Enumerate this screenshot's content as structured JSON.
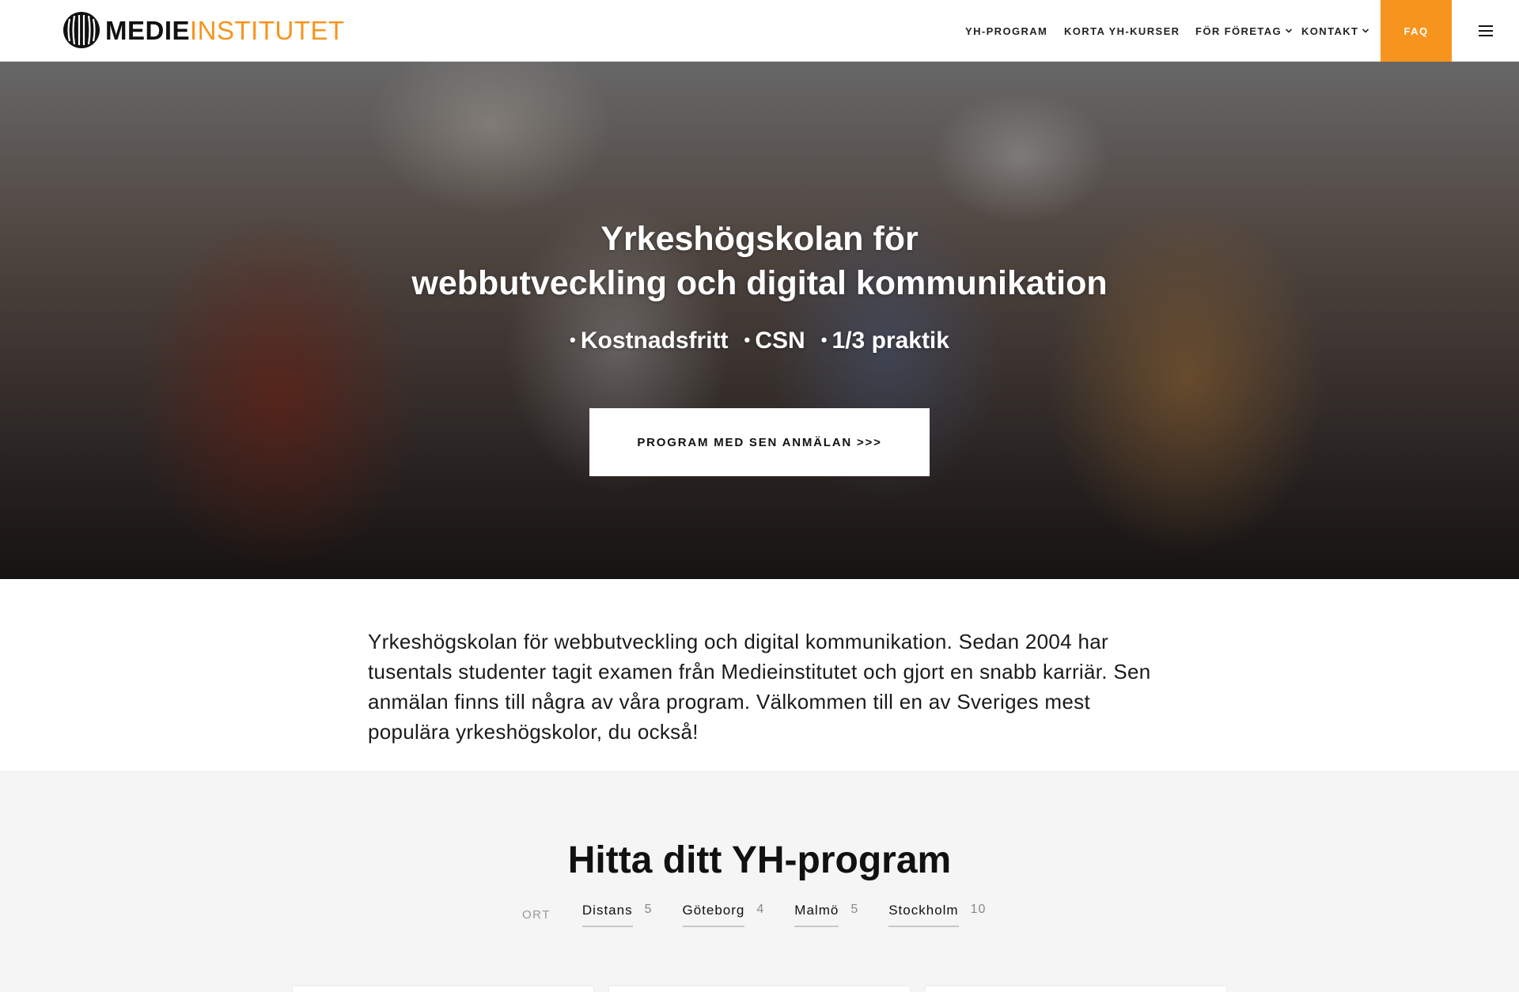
{
  "header": {
    "logo": {
      "part1": "MEDIE",
      "part2": "INSTITUTET"
    },
    "nav": [
      {
        "label": "YH-PROGRAM"
      },
      {
        "label": "KORTA YH-KURSER"
      },
      {
        "label": "FÖR FÖRETAG"
      },
      {
        "label": "KONTAKT"
      }
    ],
    "faq_label": "FAQ",
    "menu_icon": "hamburger-icon"
  },
  "hero": {
    "title_line1": "Yrkeshögskolan för",
    "title_line2": "webbutveckling och digital kommunikation",
    "bullets": [
      "Kostnadsfritt",
      "CSN",
      "1/3 praktik"
    ],
    "button_label": "PROGRAM MED SEN ANMÄLAN >>>"
  },
  "intro": {
    "text": "Yrkeshögskolan för webbutveckling och digital kommunikation. Sedan 2004 har tusentals studenter tagit examen från Medieinstitutet och gjort en snabb karriär. Sen anmälan finns till några av våra program. Välkommen till en av Sveriges mest populära yrkeshögskolor, du också!"
  },
  "find": {
    "title": "Hitta ditt YH-program",
    "filter_label": "ORT",
    "locations": [
      {
        "name": "Distans",
        "count": "5"
      },
      {
        "name": "Göteborg",
        "count": "4"
      },
      {
        "name": "Malmö",
        "count": "5"
      },
      {
        "name": "Stockholm",
        "count": "10"
      }
    ]
  },
  "colors": {
    "accent": "#f7941d",
    "background_alt": "#f5f5f5"
  }
}
